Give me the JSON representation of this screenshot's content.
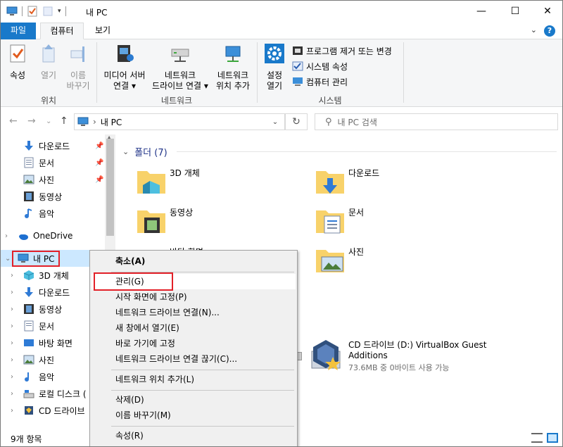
{
  "window": {
    "title": "내 PC"
  },
  "ribbon_tabs": {
    "file": "파일",
    "computer": "컴퓨터",
    "view": "보기"
  },
  "ribbon": {
    "properties": "속성",
    "open": "열기",
    "rename_line1": "이름",
    "rename_line2": "바꾸기",
    "location_group": "위치",
    "media_server_line1": "미디어 서버",
    "media_server_line2": "연결",
    "map_drive_line1": "네트워크",
    "map_drive_line2": "드라이브 연결",
    "add_location_line1": "네트워크",
    "add_location_line2": "위치 추가",
    "network_group": "네트워크",
    "settings_line1": "설정",
    "settings_line2": "열기",
    "uninstall": "프로그램 제거 또는 변경",
    "system_props": "시스템 속성",
    "computer_mgmt": "컴퓨터 관리",
    "system_group": "시스템"
  },
  "address": {
    "path": "내 PC",
    "search_placeholder": "내 PC 검색"
  },
  "nav": {
    "quick": [
      "다운로드",
      "문서",
      "사진",
      "동영상",
      "음악"
    ],
    "onedrive": "OneDrive",
    "this_pc": "내 PC",
    "pc_children": [
      "3D 개체",
      "다운로드",
      "동영상",
      "문서",
      "바탕 화면",
      "사진",
      "음악",
      "로컬 디스크 (",
      "CD 드라이브"
    ]
  },
  "content": {
    "folders_header": "폴더 (7)",
    "folders": [
      "3D 개체",
      "다운로드",
      "동영상",
      "문서",
      "바탕 화면",
      "사진"
    ],
    "drive_name": "CD 드라이브 (D:) VirtualBox Guest Additions",
    "drive_info": "73.6MB 중 0바이트 사용 가능"
  },
  "status": {
    "count": "9개 항목"
  },
  "context_menu": {
    "items": [
      "축소(A)",
      "관리(G)",
      "시작 화면에 고정(P)",
      "네트워크 드라이브 연결(N)...",
      "새 창에서 열기(E)",
      "바로 가기에 고정",
      "네트워크 드라이브 연결 끊기(C)...",
      "네트워크 위치 추가(L)",
      "삭제(D)",
      "이름 바꾸기(M)",
      "속성(R)"
    ]
  },
  "colors": {
    "accent": "#1979ca",
    "selection": "#cce8ff",
    "highlight_box": "#e22028",
    "folder": "#f8d26a"
  }
}
